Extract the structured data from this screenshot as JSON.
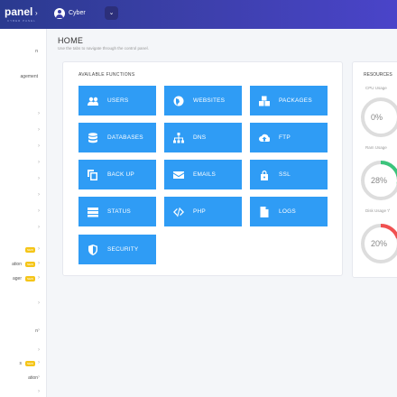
{
  "header": {
    "brand": "panel",
    "brand_sub": "CYBER PANEL",
    "collapse_icon": "chevron-right-icon",
    "user_name": "Cyber",
    "user_dropdown_icon": "chevron-down-icon"
  },
  "sidebar": {
    "items": [
      {
        "label": "n",
        "chevron": ""
      },
      {
        "label": "agement",
        "chevron": ""
      },
      {
        "label": "",
        "chevron": "›"
      },
      {
        "label": "",
        "chevron": "›"
      },
      {
        "label": "",
        "chevron": "›"
      },
      {
        "label": "",
        "chevron": "›"
      },
      {
        "label": "",
        "chevron": "›"
      },
      {
        "label": "",
        "chevron": "›"
      },
      {
        "label": "",
        "chevron": "›"
      },
      {
        "label": "",
        "chevron": "›"
      },
      {
        "label": "",
        "chevron": "›",
        "badge": "NEW"
      },
      {
        "label": "ation",
        "chevron": "›",
        "badge": "NEW"
      },
      {
        "label": "ager",
        "chevron": "›",
        "badge": "NEW"
      },
      {
        "label": "",
        "chevron": "›"
      },
      {
        "label": "n",
        "chevron": "›"
      },
      {
        "label": "",
        "chevron": "›"
      },
      {
        "label": "s",
        "chevron": "›",
        "badge": "NEW"
      },
      {
        "label": "ation",
        "chevron": "›"
      },
      {
        "label": "",
        "chevron": "›"
      }
    ]
  },
  "page": {
    "title": "HOME",
    "subtitle": "Use the tabs to navigate through the control panel."
  },
  "functions": {
    "title": "AVAILABLE FUNCTIONS",
    "buttons": [
      {
        "label": "USERS",
        "icon": "users-icon"
      },
      {
        "label": "WEBSITES",
        "icon": "globe-icon"
      },
      {
        "label": "PACKAGES",
        "icon": "cubes-icon"
      },
      {
        "label": "DATABASES",
        "icon": "database-icon"
      },
      {
        "label": "DNS",
        "icon": "sitemap-icon"
      },
      {
        "label": "FTP",
        "icon": "cloud-upload-icon"
      },
      {
        "label": "BACK UP",
        "icon": "copy-icon"
      },
      {
        "label": "EMAILS",
        "icon": "envelope-icon"
      },
      {
        "label": "SSL",
        "icon": "lock-icon"
      },
      {
        "label": "STATUS",
        "icon": "server-icon"
      },
      {
        "label": "PHP",
        "icon": "code-icon"
      },
      {
        "label": "LOGS",
        "icon": "file-icon"
      },
      {
        "label": "SECURITY",
        "icon": "shield-icon"
      }
    ]
  },
  "resources": {
    "title": "RESOURCES",
    "gauges": [
      {
        "label": "CPU Usage",
        "value": "0%",
        "percent": 0,
        "color": "#dddddd"
      },
      {
        "label": "Ram Usage",
        "value": "28%",
        "percent": 28,
        "color": "#3cc47c"
      },
      {
        "label": "Disk Usage '/'",
        "value": "20%",
        "percent": 20,
        "color": "#f05050"
      }
    ]
  },
  "colors": {
    "accent": "#2f9cf5",
    "header_start": "#2a3a8f",
    "header_end": "#4a44c9"
  }
}
